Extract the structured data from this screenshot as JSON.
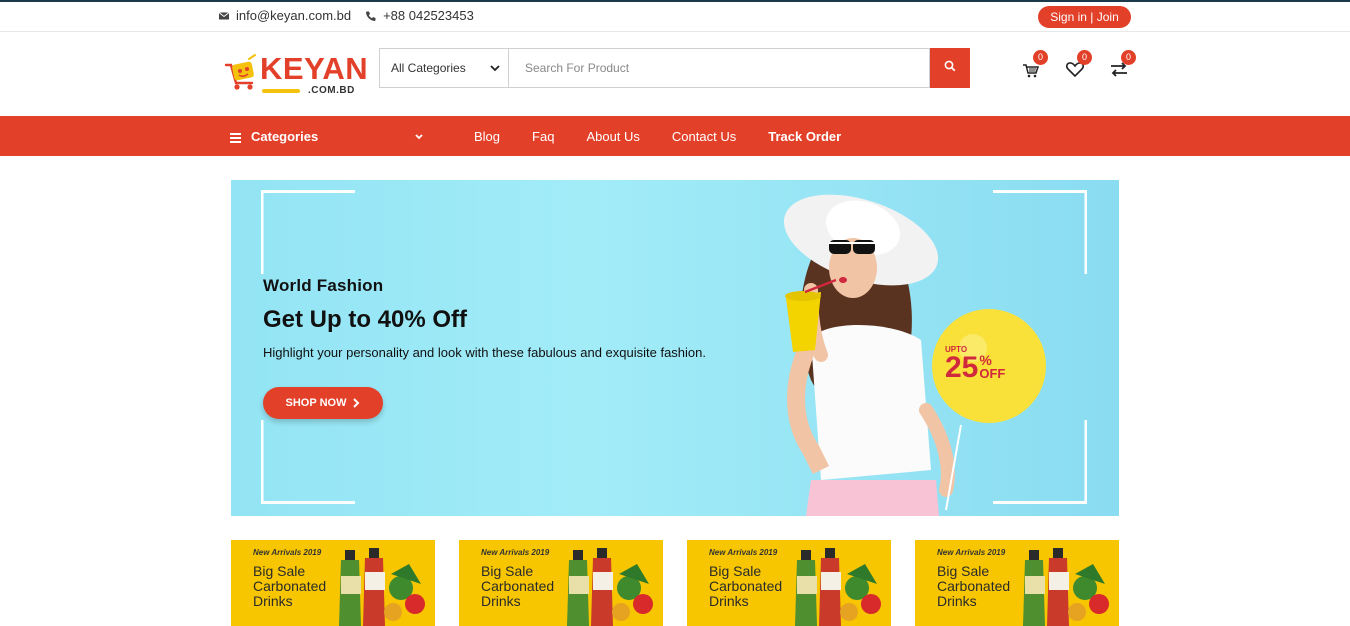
{
  "topbar": {
    "email": "info@keyan.com.bd",
    "phone": "+88 042523453",
    "signin_label": "Sign in | Join"
  },
  "header": {
    "logo_text": "KEYAN",
    "logo_sub": ".COM.BD",
    "category_select": "All Categories",
    "search_placeholder": "Search For Product",
    "cart_count": "0",
    "wishlist_count": "0",
    "compare_count": "0"
  },
  "nav": {
    "categories_label": "Categories",
    "links": [
      {
        "label": "Blog"
      },
      {
        "label": "Faq"
      },
      {
        "label": "About Us"
      },
      {
        "label": "Contact Us"
      },
      {
        "label": "Track Order"
      }
    ]
  },
  "hero": {
    "eyebrow": "World Fashion",
    "headline": "Get Up to 40% Off",
    "description": "Highlight your personality and look with these fabulous and exquisite fashion.",
    "button_label": "SHOP NOW",
    "balloon_upto": "UPTO",
    "balloon_value": "25",
    "balloon_percent": "%",
    "balloon_off": "OFF"
  },
  "promos": [
    {
      "small": "New Arrivals 2019",
      "big": "Big Sale Carbonated Drinks"
    },
    {
      "small": "New Arrivals 2019",
      "big": "Big Sale Carbonated Drinks"
    },
    {
      "small": "New Arrivals 2019",
      "big": "Big Sale Carbonated Drinks"
    },
    {
      "small": "New Arrivals 2019",
      "big": "Big Sale Carbonated Drinks"
    }
  ],
  "colors": {
    "accent": "#e3402a",
    "hero_bg": "#9ae8f6",
    "promo_bg": "#f7c600",
    "balloon": "#f9e13a"
  }
}
